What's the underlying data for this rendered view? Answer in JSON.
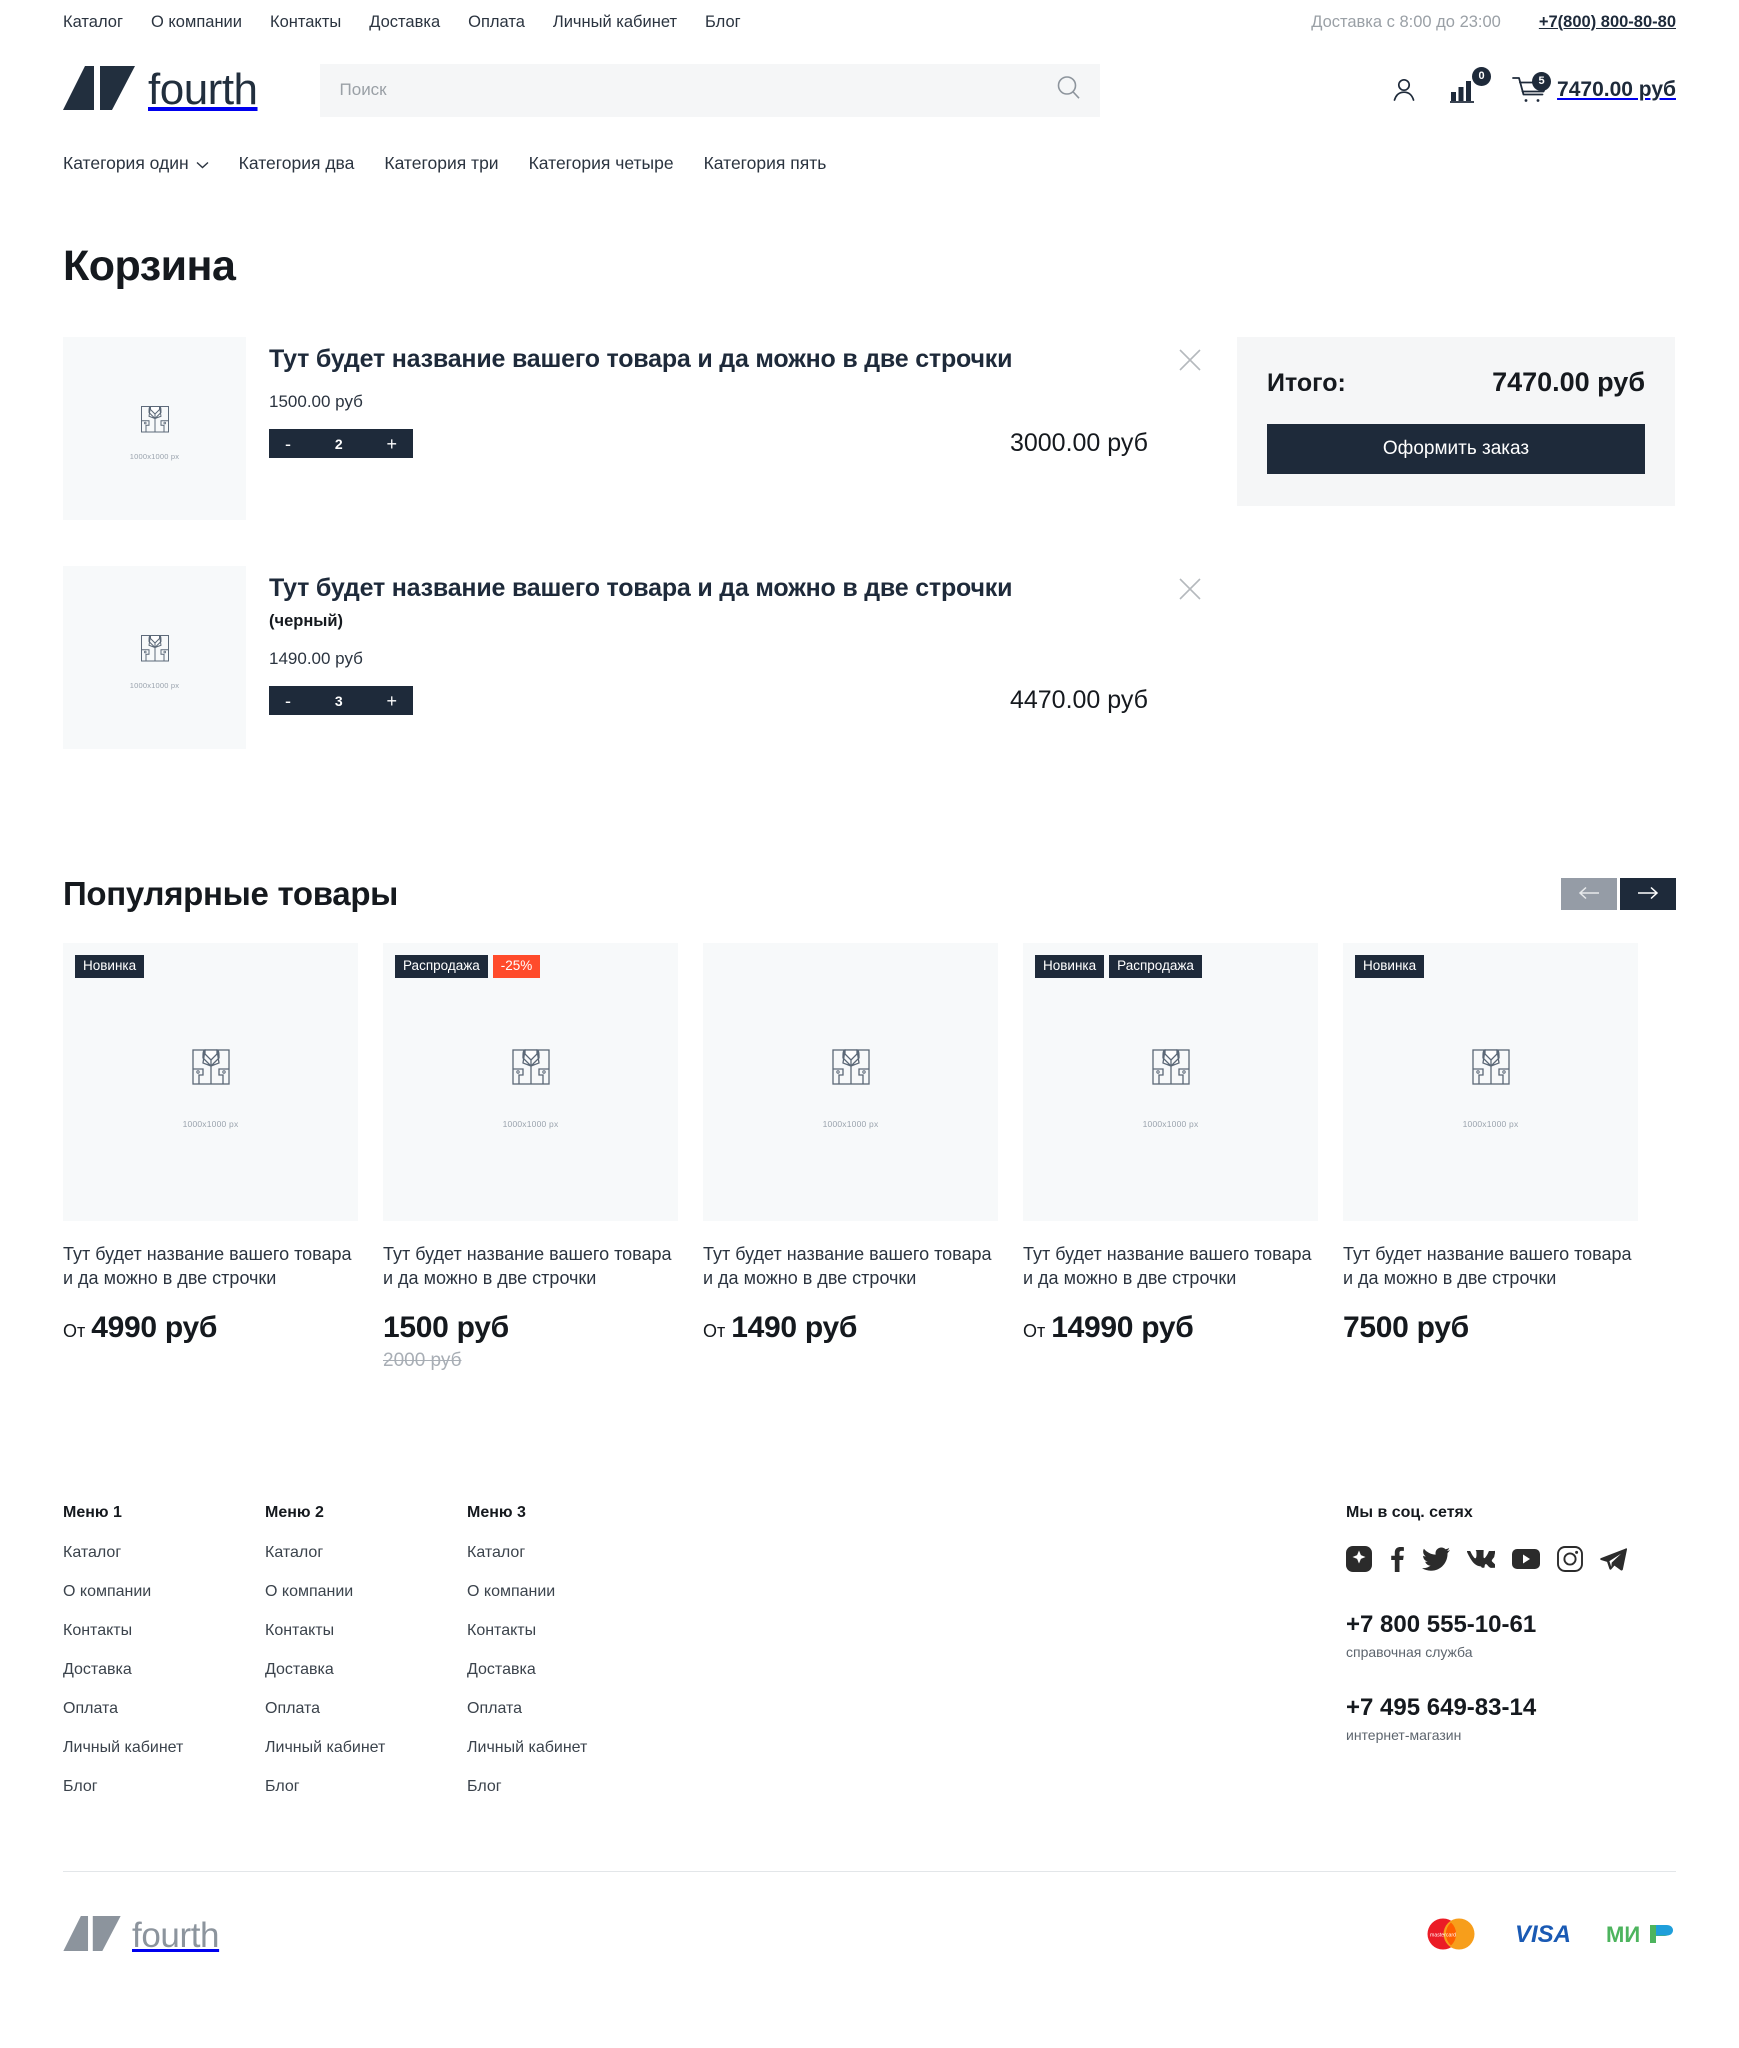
{
  "topbar": {
    "nav": [
      {
        "label": "Каталог"
      },
      {
        "label": "О компании"
      },
      {
        "label": "Контакты"
      },
      {
        "label": "Доставка"
      },
      {
        "label": "Оплата"
      },
      {
        "label": "Личный кабинет"
      },
      {
        "label": "Блог"
      }
    ],
    "delivery_hours": "Доставка с 8:00 до 23:00",
    "phone": "+7(800) 800-80-80"
  },
  "header": {
    "logo_text": "fourth",
    "search_placeholder": "Поиск",
    "search_value": "",
    "compare_count": "0",
    "cart_count": "5",
    "cart_total": "7470.00 руб"
  },
  "categories": [
    {
      "label": "Категория один",
      "has_chevron": true
    },
    {
      "label": "Категория два",
      "has_chevron": false
    },
    {
      "label": "Категория три",
      "has_chevron": false
    },
    {
      "label": "Категория четыре",
      "has_chevron": false
    },
    {
      "label": "Категория пять",
      "has_chevron": false
    }
  ],
  "page_title": "Корзина",
  "cart": {
    "items": [
      {
        "name": "Тут будет название вашего товара и да можно в две строчки",
        "variant": "",
        "unit_price": "1500.00 руб",
        "quantity": "2",
        "line_total": "3000.00 руб",
        "thumb_caption": "1000x1000 px",
        "minus": "-",
        "plus": "+"
      },
      {
        "name": "Тут будет название вашего товара и да можно в две строчки",
        "variant": "(черный)",
        "unit_price": "1490.00 руб",
        "quantity": "3",
        "line_total": "4470.00 руб",
        "thumb_caption": "1000x1000 px",
        "minus": "-",
        "plus": "+"
      }
    ],
    "summary": {
      "label": "Итого:",
      "value": "7470.00 руб",
      "checkout_label": "Оформить заказ"
    }
  },
  "popular": {
    "title": "Популярные товары",
    "products": [
      {
        "badges": [
          {
            "text": "Новинка",
            "type": "dark"
          }
        ],
        "caption": "1000x1000 px",
        "name": "Тут будет название вашего товара и да можно в две строчки",
        "price_prefix": "От",
        "price": "4990 руб",
        "old_price": ""
      },
      {
        "badges": [
          {
            "text": "Распродажа",
            "type": "dark"
          },
          {
            "text": "-25%",
            "type": "sale"
          }
        ],
        "caption": "1000x1000 px",
        "name": "Тут будет название вашего товара и да можно в две строчки",
        "price_prefix": "",
        "price": "1500 руб",
        "old_price": "2000 руб"
      },
      {
        "badges": [],
        "caption": "1000x1000 px",
        "name": "Тут будет название вашего товара и да можно в две строчки",
        "price_prefix": "От",
        "price": "1490 руб",
        "old_price": ""
      },
      {
        "badges": [
          {
            "text": "Новинка",
            "type": "dark"
          },
          {
            "text": "Распродажа",
            "type": "dark"
          }
        ],
        "caption": "1000x1000 px",
        "name": "Тут будет название вашего товара и да можно в две строчки",
        "price_prefix": "От",
        "price": "14990 руб",
        "old_price": ""
      },
      {
        "badges": [
          {
            "text": "Новинка",
            "type": "dark"
          }
        ],
        "caption": "1000x1000 px",
        "name": "Тут будет название вашего товара и да можно в две строчки",
        "price_prefix": "",
        "price": "7500 руб",
        "old_price": ""
      }
    ]
  },
  "footer": {
    "menus": [
      {
        "title": "Меню 1",
        "links": [
          "Каталог",
          "О компании",
          "Контакты",
          "Доставка",
          "Оплата",
          "Личный кабинет",
          "Блог"
        ]
      },
      {
        "title": "Меню 2",
        "links": [
          "Каталог",
          "О компании",
          "Контакты",
          "Доставка",
          "Оплата",
          "Личный кабинет",
          "Блог"
        ]
      },
      {
        "title": "Меню 3",
        "links": [
          "Каталог",
          "О компании",
          "Контакты",
          "Доставка",
          "Оплата",
          "Личный кабинет",
          "Блог"
        ]
      }
    ],
    "social_title": "Мы в соц. сетях",
    "social_icons": [
      "odnoklassniki-icon",
      "facebook-icon",
      "twitter-icon",
      "vk-icon",
      "youtube-icon",
      "instagram-icon",
      "telegram-icon"
    ],
    "phone1": "+7 800 555-10-61",
    "phone1_sub": "справочная служба",
    "phone2": "+7 495 649-83-14",
    "phone2_sub": "интернет-магазин",
    "logo_text": "fourth",
    "payments": [
      "mastercard-logo",
      "visa-logo",
      "mir-logo"
    ]
  },
  "colors": {
    "dark": "#1e2a3a",
    "sale": "#ff4b2b",
    "muted": "#9aa0a6",
    "panel": "#f5f6f7",
    "thumb_bg": "#f7f9fa"
  }
}
